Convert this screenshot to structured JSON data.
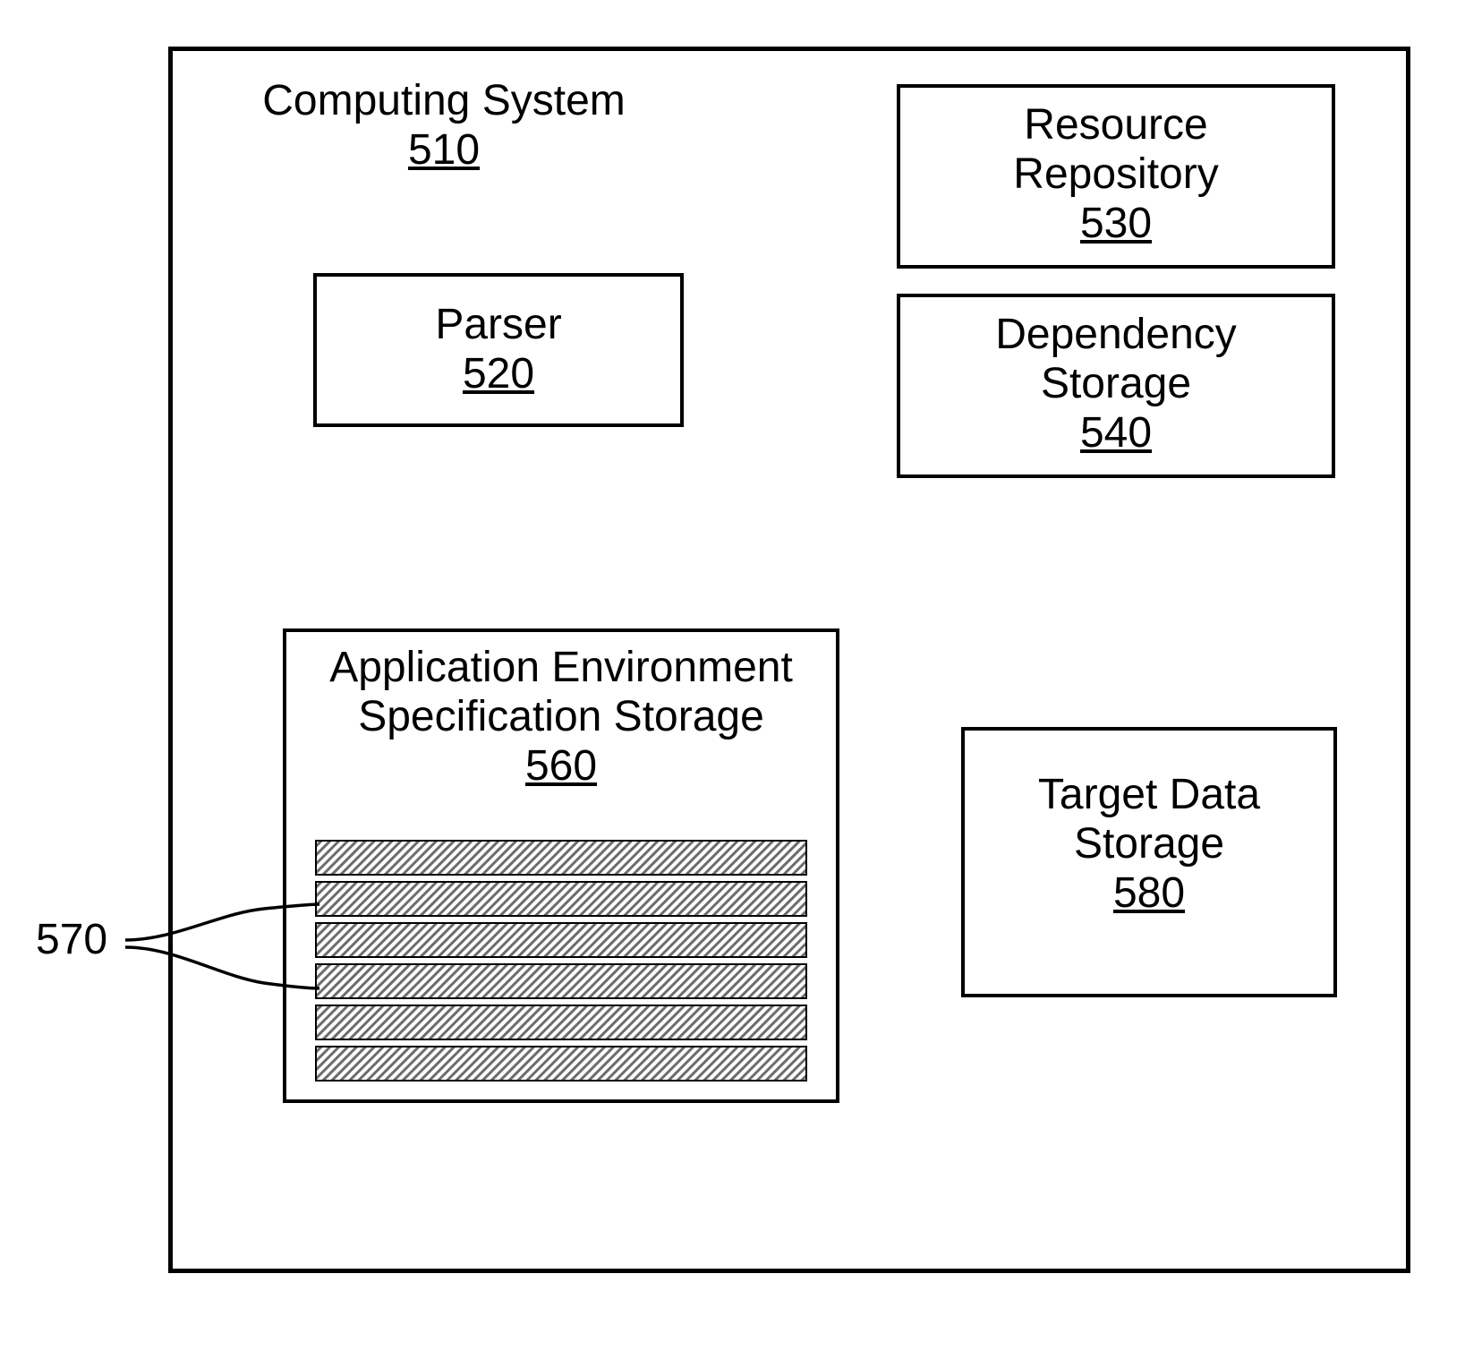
{
  "system": {
    "title": "Computing System",
    "number": "510"
  },
  "parser": {
    "title": "Parser",
    "number": "520"
  },
  "resource_repo": {
    "title_l1": "Resource",
    "title_l2": "Repository",
    "number": "530"
  },
  "dependency_storage": {
    "title_l1": "Dependency",
    "title_l2": "Storage",
    "number": "540"
  },
  "app_env": {
    "title_l1": "Application Environment",
    "title_l2": "Specification Storage",
    "number": "560"
  },
  "target_data": {
    "title_l1": "Target Data",
    "title_l2": "Storage",
    "number": "580"
  },
  "callout": {
    "number": "570"
  }
}
